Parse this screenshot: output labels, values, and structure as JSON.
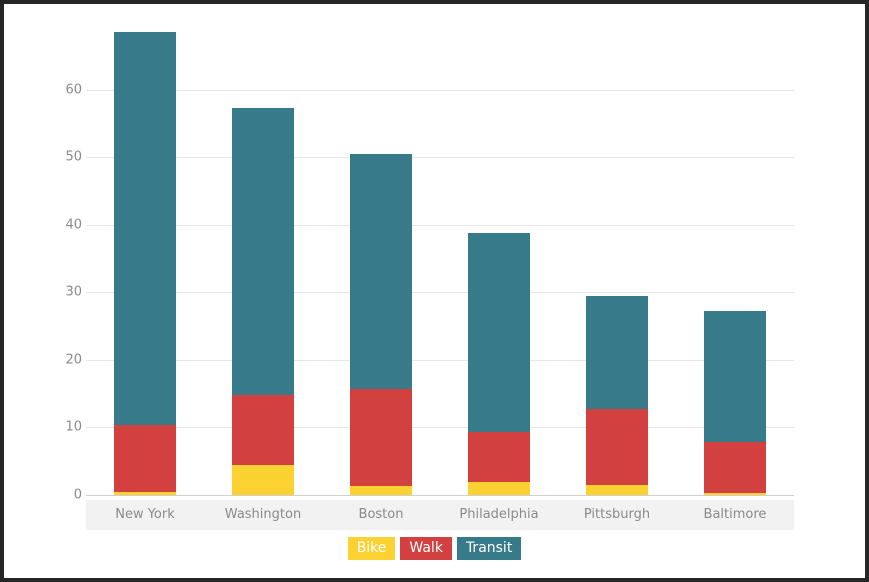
{
  "chart_data": {
    "type": "bar",
    "subtype": "stacked-bar",
    "title": "",
    "xlabel": "",
    "ylabel": "",
    "categories": [
      "New York",
      "Washington",
      "Boston",
      "Philadelphia",
      "Pittsburgh",
      "Baltimore"
    ],
    "series": [
      {
        "name": "Bike",
        "color": "#FCD232",
        "values": [
          0.4,
          4.5,
          1.3,
          1.9,
          1.5,
          0.3
        ]
      },
      {
        "name": "Walk",
        "color": "#D24040",
        "values": [
          10.0,
          10.3,
          14.4,
          7.5,
          11.2,
          7.5
        ]
      },
      {
        "name": "Transit",
        "color": "#377B8A",
        "values": [
          58.1,
          42.5,
          34.8,
          29.4,
          16.8,
          19.5
        ]
      }
    ],
    "totals": [
      68.5,
      57.3,
      50.5,
      38.8,
      29.5,
      27.3
    ],
    "ylim": [
      0,
      70
    ],
    "yticks": [
      0,
      10,
      20,
      30,
      40,
      50,
      60
    ],
    "ytick_labels": [
      "0",
      "10",
      "20",
      "30",
      "40",
      "50",
      "60"
    ],
    "grid": true,
    "legend_position": "bottom",
    "legend_style": "filled-chip",
    "axis_band_color": "#F2F2F2",
    "gridline_color": "#E6E6E6",
    "tick_label_color": "#8A8A8A",
    "frame_color": "#262626",
    "background": "#FFFFFF"
  }
}
